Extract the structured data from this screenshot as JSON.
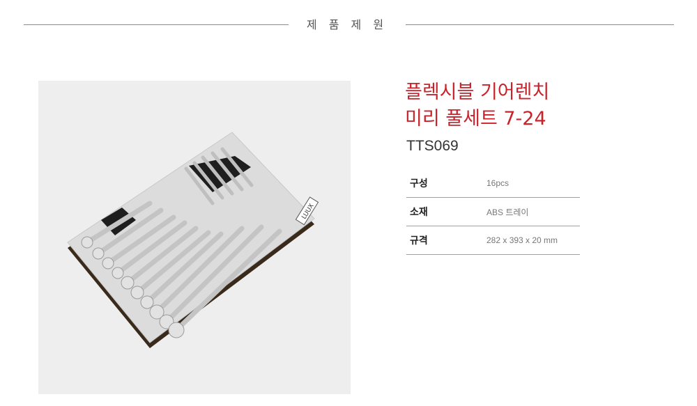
{
  "section_title": "제 품 제 원",
  "product": {
    "title_line1": "플렉시블 기어렌치",
    "title_line2": "미리 풀세트 7-24",
    "model": "TTS069",
    "tray_logo": "LUUX"
  },
  "specs": [
    {
      "label": "구성",
      "value": "16pcs"
    },
    {
      "label": "소재",
      "value": "ABS 트레이"
    },
    {
      "label": "규격",
      "value": "282 x 393  x 20 mm"
    }
  ],
  "colors": {
    "accent": "#c8232b",
    "text": "#333333",
    "divider": "#a0a0a0"
  }
}
